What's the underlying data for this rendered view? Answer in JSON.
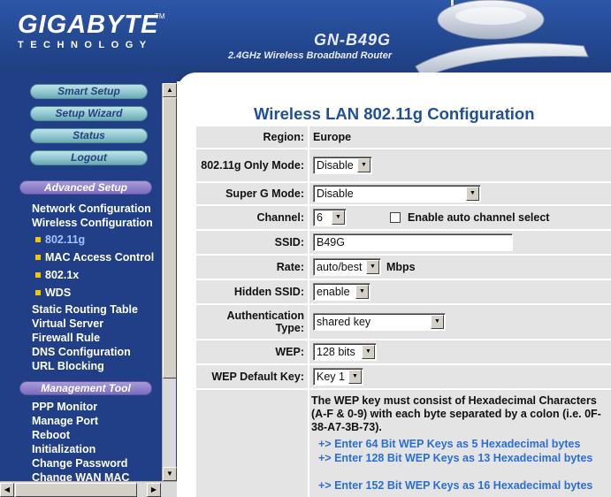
{
  "header": {
    "logo_main": "GIGABYTE",
    "logo_tm": "TM",
    "logo_sub": "TECHNOLOGY",
    "model": "GN-B49G",
    "tagline": "2.4GHz Wireless Broadband Router"
  },
  "sidebar": {
    "top_buttons": [
      "Smart Setup",
      "Setup Wizard",
      "Status",
      "Logout"
    ],
    "advanced_title": "Advanced Setup",
    "advanced_links": [
      "Network Configuration",
      "Wireless Configuration"
    ],
    "wireless_sub": [
      "802.11g",
      "MAC Access Control",
      "802.1x",
      "WDS"
    ],
    "advanced_links_2": [
      "Static Routing Table",
      "Virtual Server",
      "Firewall Rule",
      "DNS Configuration",
      "URL Blocking"
    ],
    "management_title": "Management Tool",
    "management_links": [
      "PPP Monitor",
      "Manage Port",
      "Reboot",
      "Initialization",
      "Change Password",
      "Change WAN MAC"
    ]
  },
  "scroll": {
    "up": "▲",
    "down": "▼",
    "left": "◀",
    "right": "▶"
  },
  "page": {
    "title": "Wireless LAN 802.11g Configuration",
    "region_label": "Region:",
    "region_value": "Europe",
    "only_mode_label": "802.11g Only Mode:",
    "only_mode_value": "Disable",
    "superg_label": "Super G Mode:",
    "superg_value": "Disable",
    "channel_label": "Channel:",
    "channel_value": "6",
    "auto_channel_label": "Enable auto channel select",
    "ssid_label": "SSID:",
    "ssid_value": "B49G",
    "rate_label": "Rate:",
    "rate_value": "auto/best",
    "rate_unit": "Mbps",
    "hidden_ssid_label": "Hidden SSID:",
    "hidden_ssid_value": "enable",
    "auth_label": "Authentication Type:",
    "auth_value": "shared key",
    "wep_label": "WEP:",
    "wep_value": "128 bits",
    "wep_default_label": "WEP Default Key:",
    "wep_default_value": "Key 1",
    "wep_note": "The WEP key must consist of Hexadecimal Characters (A-F & 0-9) with each byte separated by a colon (i.e. 0F-38-A7-3B-73).",
    "wep_links": [
      "+> Enter 64 Bit WEP Keys as 5 Hexadecimal bytes",
      "+> Enter 128 Bit WEP Keys as 13 Hexadecimal bytes",
      "+> Enter 152 Bit WEP Keys as 16 Hexadecimal bytes"
    ]
  }
}
